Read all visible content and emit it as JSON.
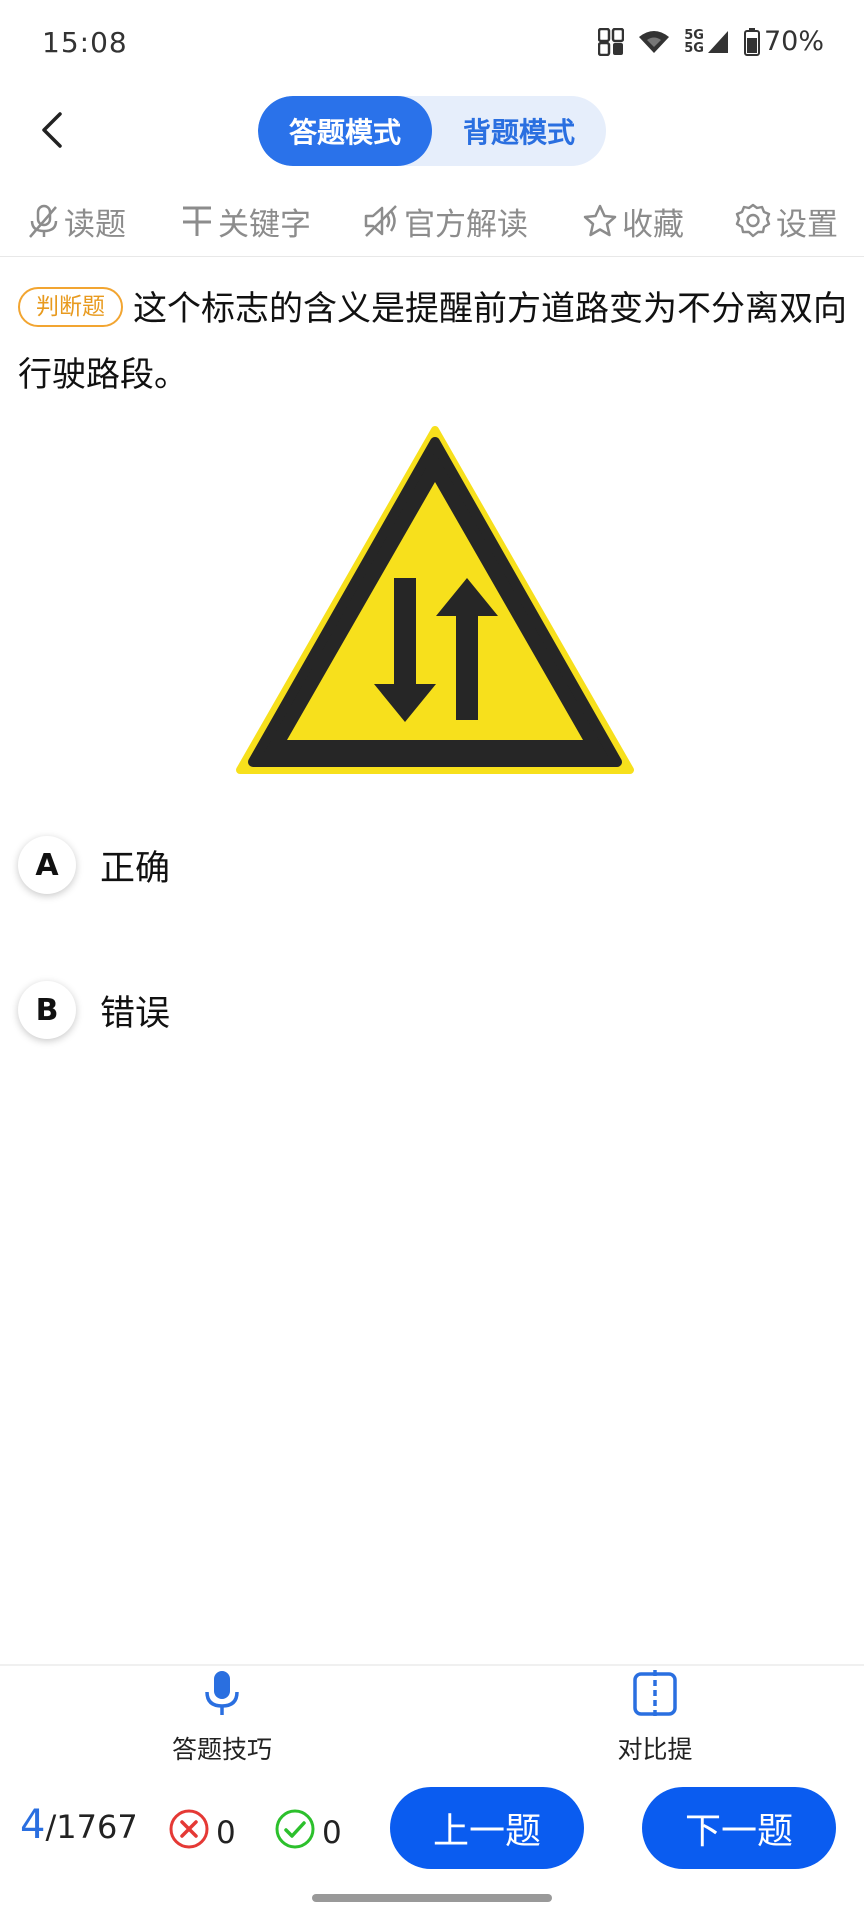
{
  "status_bar": {
    "time": "15:08",
    "network_label_top": "5G",
    "network_label_bottom": "5G",
    "battery": "70%",
    "icons": [
      "nfc-icon",
      "wifi-icon",
      "signal-icon",
      "battery-icon"
    ]
  },
  "header": {
    "back_icon": "chevron-left-icon",
    "modes": [
      {
        "label": "答题模式",
        "active": true
      },
      {
        "label": "背题模式",
        "active": false
      }
    ]
  },
  "toolbar": {
    "items": [
      {
        "label": "读题",
        "icon": "mute-microphone-icon"
      },
      {
        "label": "关键字",
        "icon": "text-keyword-icon"
      },
      {
        "label": "官方解读",
        "icon": "sound-off-icon"
      },
      {
        "label": "收藏",
        "icon": "star-icon"
      },
      {
        "label": "设置",
        "icon": "gear-icon"
      }
    ]
  },
  "question": {
    "type_tag": "判断题",
    "text": "这个标志的含义是提醒前方道路变为不分离双向行驶路段。",
    "image": "two-way-traffic-warning-sign"
  },
  "options": [
    {
      "key": "A",
      "text": "正确"
    },
    {
      "key": "B",
      "text": "错误"
    }
  ],
  "bottom_tools": [
    {
      "label": "答题技巧",
      "icon": "microphone-icon"
    },
    {
      "label": "对比提",
      "icon": "compare-icon"
    }
  ],
  "footer": {
    "current": "4",
    "total": "/1767",
    "wrong_count": "0",
    "right_count": "0",
    "prev_label": "上一题",
    "next_label": "下一题"
  },
  "colors": {
    "accent": "#2a72ea",
    "button": "#0a5cf0",
    "tag": "#e89a1e",
    "wrong": "#e53935",
    "right": "#2cc02c",
    "sign_yellow": "#f7e01c"
  }
}
